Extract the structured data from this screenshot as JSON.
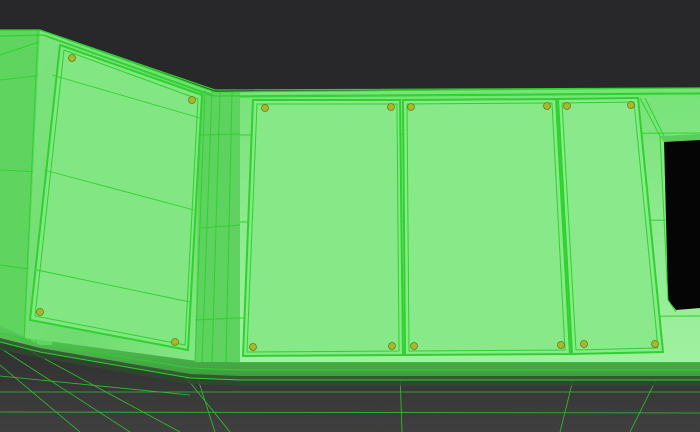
{
  "viewport": {
    "background": "#28282a",
    "wireframe_color": "#2fd12f",
    "surface_color": "#6fe06f",
    "surface_highlight": "#9cf09c",
    "surface_shadow": "#46b546",
    "screw_color": "#a7b82a",
    "cutout_color": "#050505",
    "floor_color": "#3a3a3a"
  },
  "scene": {
    "object": "paneled-wall-mesh",
    "panels": [
      {
        "name": "left-angled-panel",
        "screws": 4
      },
      {
        "name": "center-left-panel",
        "screws": 4
      },
      {
        "name": "center-right-panel",
        "screws": 4
      },
      {
        "name": "right-panel",
        "screws": 4
      }
    ],
    "has_window_cutout": true,
    "mode": "wireframe-on-shaded"
  }
}
